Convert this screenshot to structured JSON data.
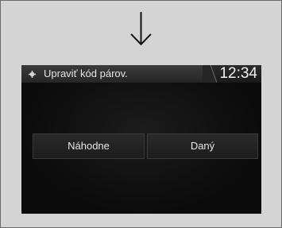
{
  "screen": {
    "title": "Upraviť kód párov.",
    "clock": "12:34",
    "icon": "gear-icon"
  },
  "options": [
    {
      "label": "Náhodne"
    },
    {
      "label": "Daný"
    }
  ],
  "arrow": {
    "icon": "down-arrow-icon"
  },
  "colors": {
    "frame_background": "#d4d4d4",
    "screen_background": "#0b0b0b",
    "text": "#e8e8e8"
  }
}
